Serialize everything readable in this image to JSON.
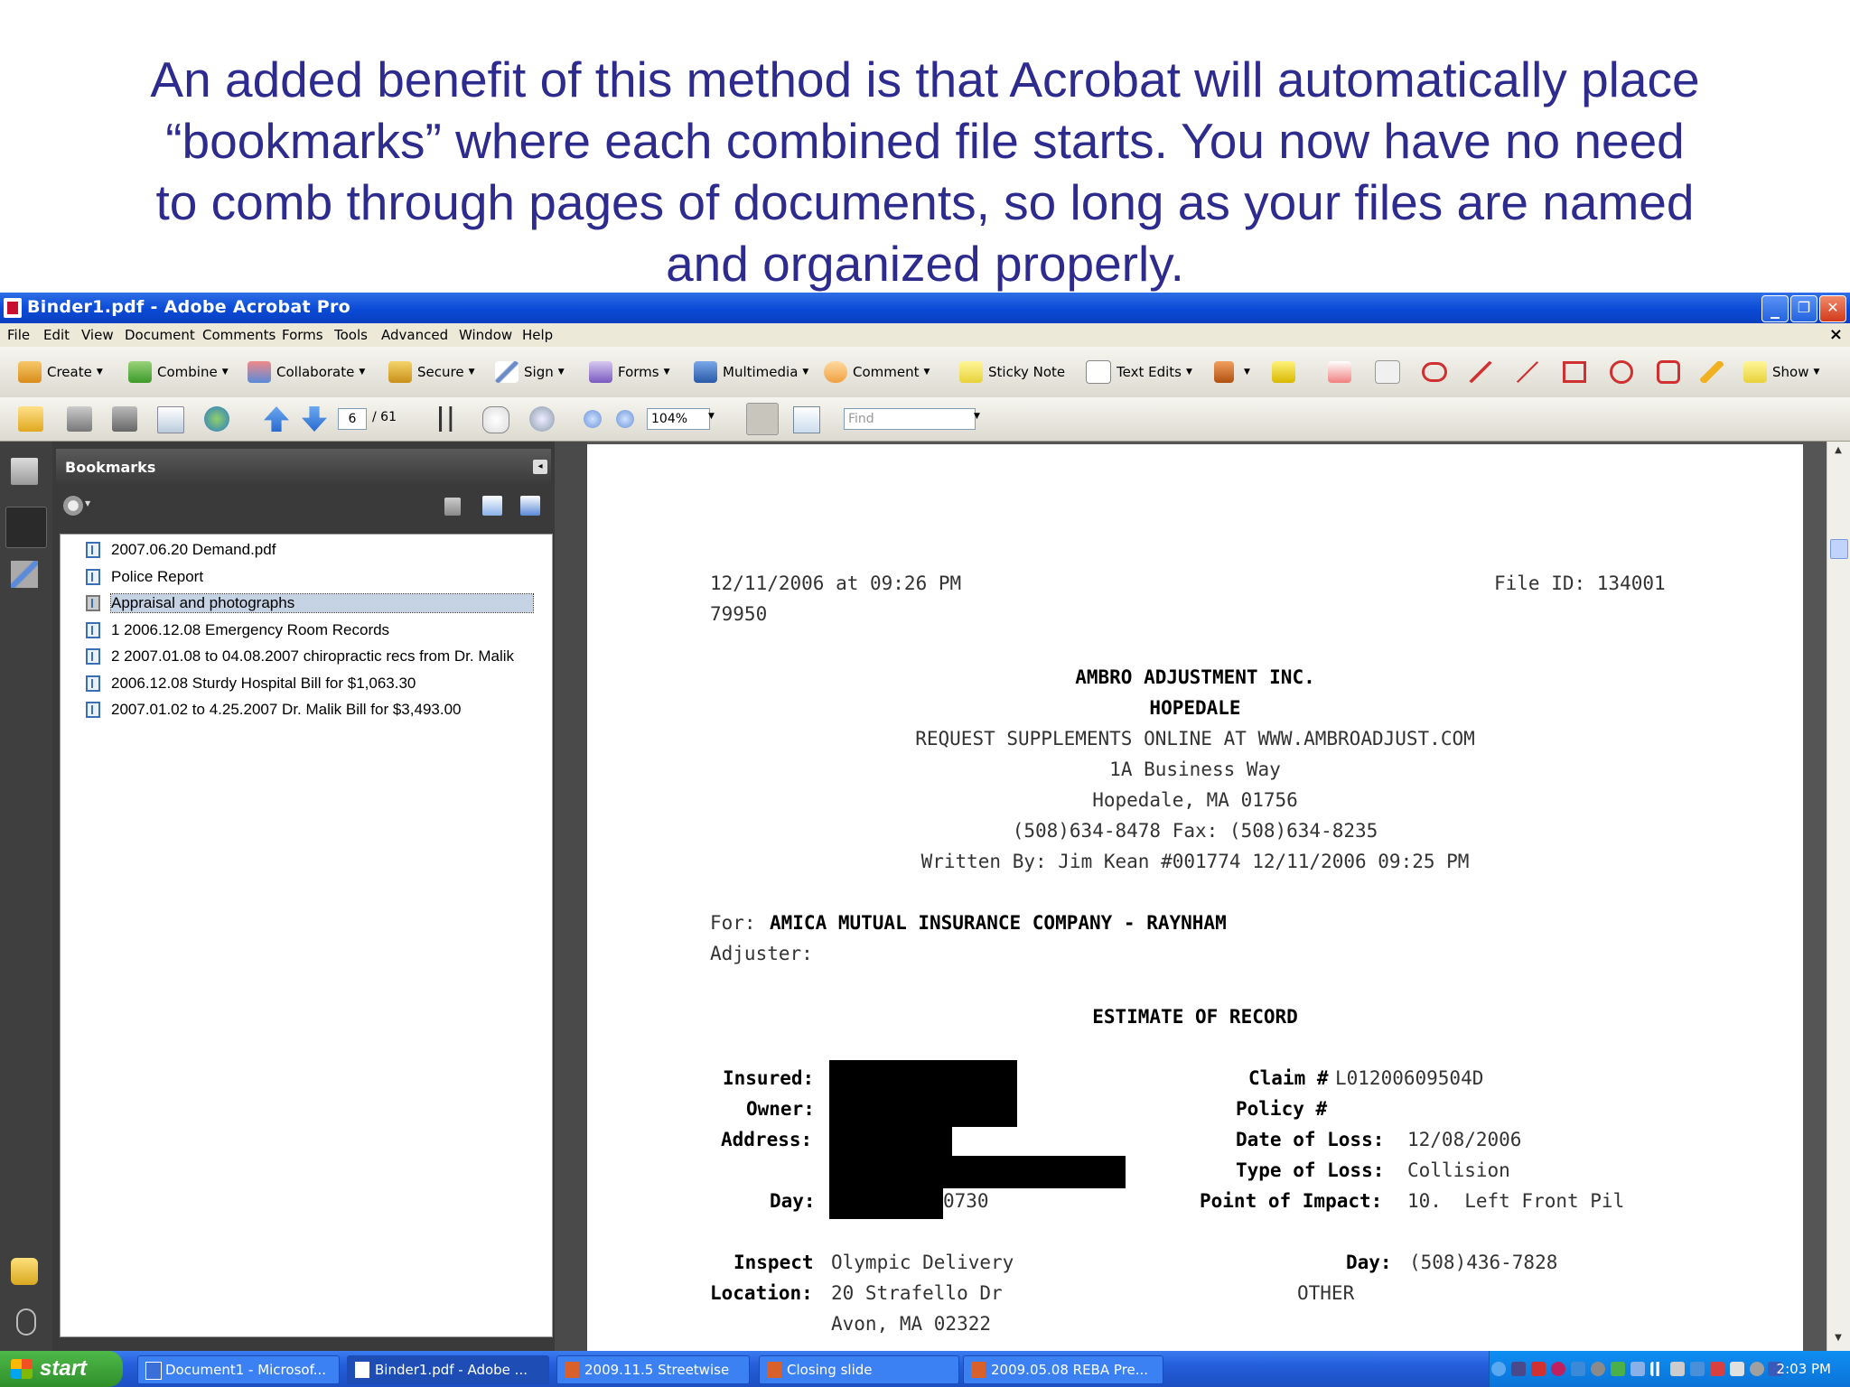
{
  "slide": {
    "caption_lines": [
      "An added benefit of this method is that Acrobat will automatically place",
      "“bookmarks” where each combined file starts.  You now have no need",
      "to comb through pages of documents, so long as your files are named",
      "and organized properly."
    ]
  },
  "window": {
    "title": "Binder1.pdf - Adobe Acrobat Pro",
    "min_glyph": "_",
    "restore_glyph": "❐",
    "close_glyph": "✕"
  },
  "menu": {
    "items": [
      "File",
      "Edit",
      "View",
      "Document",
      "Comments",
      "Forms",
      "Tools",
      "Advanced",
      "Window",
      "Help"
    ],
    "close_glyph": "×"
  },
  "toolbar": {
    "create": "Create",
    "combine": "Combine",
    "collaborate": "Collaborate",
    "secure": "Secure",
    "sign": "Sign",
    "forms": "Forms",
    "multimedia": "Multimedia",
    "comment": "Comment",
    "sticky_note": "Sticky Note",
    "text_edits": "Text Edits",
    "show": "Show",
    "caret": "▼"
  },
  "nav": {
    "page": "6",
    "total": "/ 61",
    "zoom": "104%",
    "find_placeholder": "Find"
  },
  "bookmarks": {
    "title": "Bookmarks",
    "collapse_glyph": "◂",
    "items": [
      "2007.06.20 Demand.pdf",
      "Police Report",
      "Appraisal and photographs",
      "1 2006.12.08 Emergency Room Records",
      "2 2007.01.08 to 04.08.2007 chiropractic recs from Dr. Malik",
      "2006.12.08 Sturdy Hospital Bill for $1,063.30",
      "2007.01.02 to 4.25.2007 Dr. Malik Bill for $3,493.00"
    ],
    "selected": "Appraisal and photographs"
  },
  "document": {
    "date_line": "12/11/2006 at 09:26 PM",
    "file_id": "File ID: 134001",
    "ref": "79950",
    "company": "AMBRO ADJUSTMENT INC.",
    "branch": "HOPEDALE",
    "supplements": "REQUEST SUPPLEMENTS ONLINE AT WWW.AMBROADJUST.COM",
    "street": "1A Business Way",
    "city": "Hopedale, MA 01756",
    "phone": "(508)634-8478 Fax: (508)634-8235",
    "written_by": "Written By: Jim Kean #001774 12/11/2006 09:25 PM",
    "for_label": "For:",
    "for_value": "AMICA MUTUAL INSURANCE COMPANY - RAYNHAM",
    "adjuster_label": "Adjuster:",
    "estimate_title": "ESTIMATE OF RECORD",
    "insured_label": "Insured:",
    "owner_label": "Owner:",
    "address_label": "Address:",
    "day_label": "Day:",
    "day_partial": "0730",
    "claim_label": "Claim #",
    "claim_value": "L01200609504D",
    "policy_label": "Policy #",
    "dol_label": "Date of Loss:",
    "dol_value": "12/08/2006",
    "tol_label": "Type of Loss:",
    "tol_value": "Collision",
    "poi_label": "Point of Impact:",
    "poi_value": "10.  Left Front Pil",
    "inspect_label": "Inspect",
    "inspect_value": "Olympic Delivery",
    "location_label": "Location:",
    "location_value1": "20 Strafello Dr",
    "location_value2": "Avon, MA 02322",
    "day2_label": "Day:",
    "day2_value": "(508)436-7828",
    "other": "OTHER"
  },
  "taskbar": {
    "start": "start",
    "tasks": [
      "Document1 - Microsof...",
      "Binder1.pdf - Adobe ...",
      "2009.11.5 Streetwise",
      "Closing slide",
      "2009.05.08 REBA Pre..."
    ],
    "clock": "2:03 PM"
  },
  "colors": {
    "caption": "#2e2b8f",
    "titlebar": "#0a4ad6",
    "selection": "#c5d3e5"
  }
}
